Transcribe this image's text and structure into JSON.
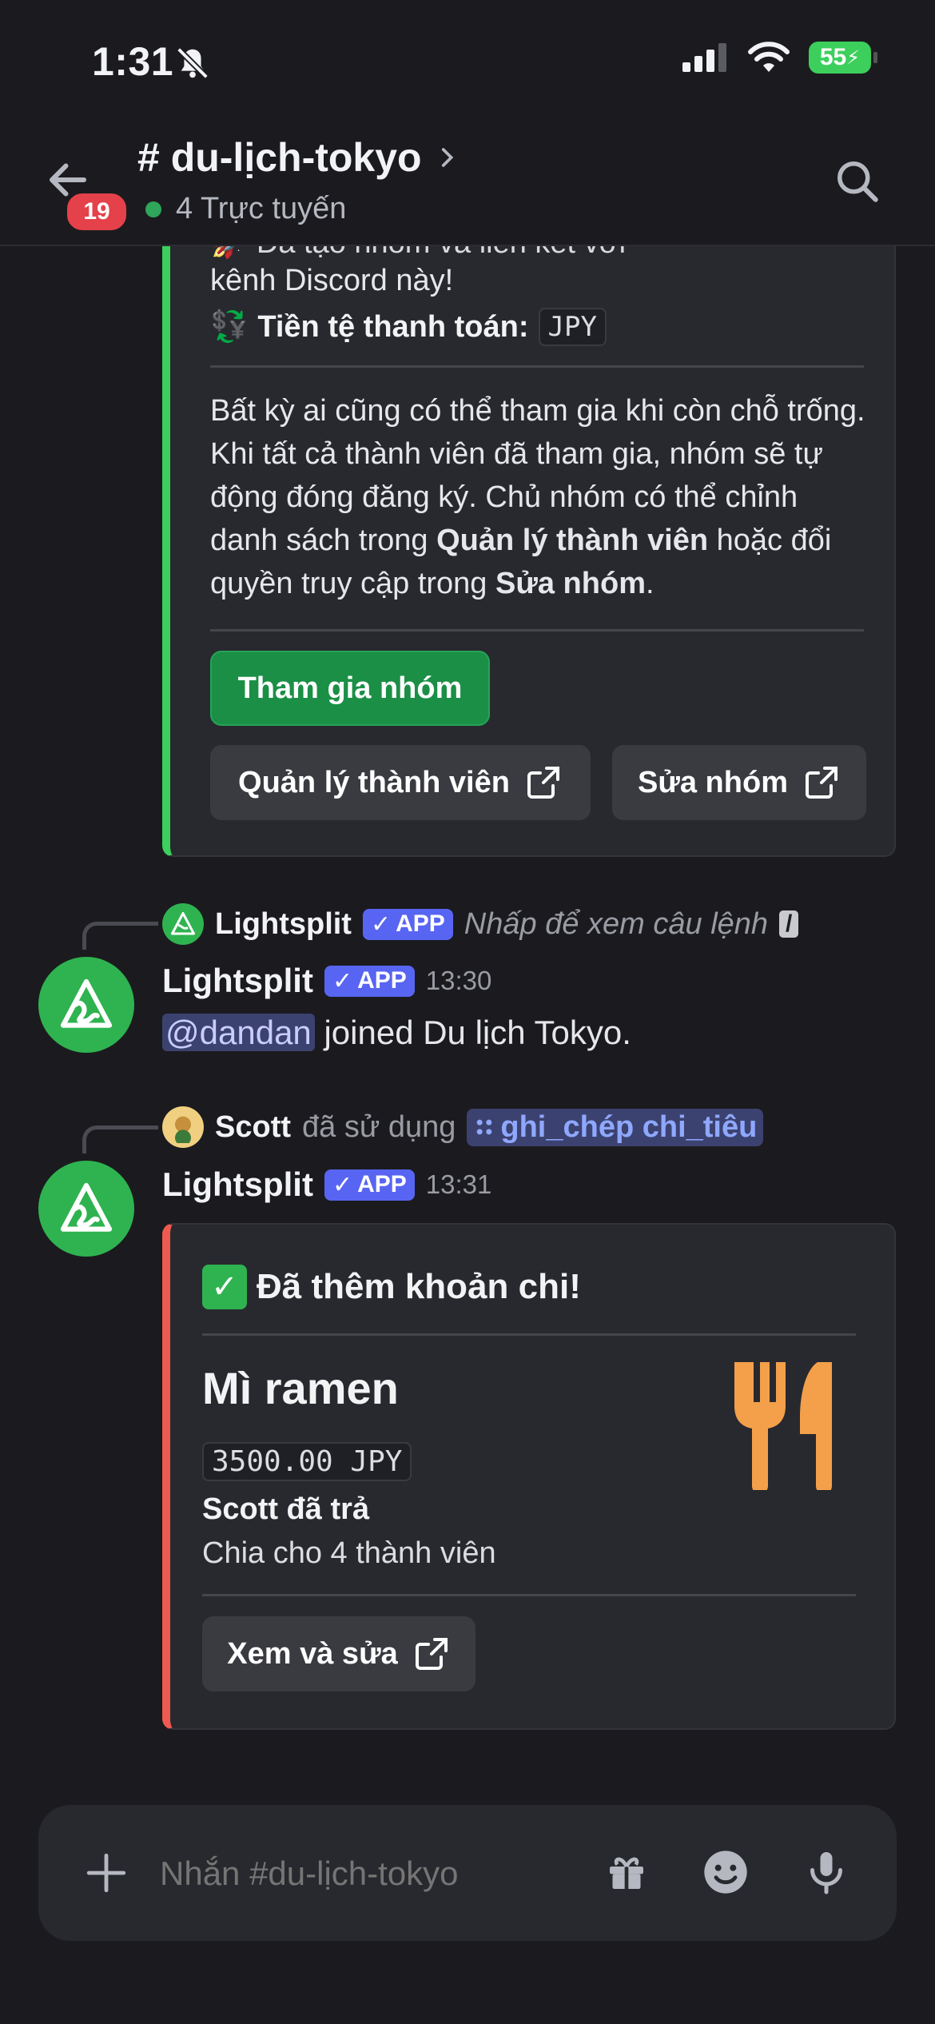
{
  "status_bar": {
    "time": "1:31",
    "battery": "55"
  },
  "header": {
    "channel_name": "# du-lịch-tokyo",
    "online_text": "4 Trực tuyến",
    "back_badge": "19"
  },
  "embed_top": {
    "cut_line": "Đã tạo nhóm và liên kết với",
    "line2": "kênh Discord này!",
    "currency_emoji": "💱",
    "currency_label": "Tiền tệ thanh toán:",
    "currency_value": "JPY",
    "para_1": "Bất kỳ ai cũng có thể tham gia khi còn chỗ trống. Khi tất cả thành viên đã tham gia, nhóm sẽ tự động đóng đăng ký. Chủ nhóm có thể chỉnh danh sách trong ",
    "para_bold_1": "Quản lý thành viên",
    "para_2": " hoặc đổi quyền truy cập trong ",
    "para_bold_2": "Sửa nhóm",
    "para_3": ".",
    "join_button": "Tham gia nhóm",
    "manage_button": "Quản lý thành viên",
    "edit_button": "Sửa nhóm"
  },
  "message_1": {
    "reply_name": "Lightsplit",
    "reply_hint": "Nhấp để xem câu lệnh",
    "app_tag": "APP",
    "author": "Lightsplit",
    "time": "13:30",
    "mention": "@dandan",
    "text": " joined Du lịch Tokyo."
  },
  "message_2": {
    "reply_name": "Scott",
    "reply_used": "đã sử dụng",
    "command": "ghi_chép chi_tiêu",
    "app_tag": "APP",
    "author": "Lightsplit",
    "time": "13:31"
  },
  "embed_expense": {
    "title_emoji": "✅",
    "title": "Đã thêm khoản chi!",
    "item": "Mì ramen",
    "amount": "3500.00 JPY",
    "paid_by": "Scott đã trả",
    "split": "Chia cho 4 thành viên",
    "view_button": "Xem và sửa"
  },
  "composer": {
    "placeholder": "Nhắn #du-lịch-tokyo"
  },
  "colors": {
    "accent_green": "#3ccf5c",
    "accent_red": "#ef5a50",
    "app_blue": "#5865f2"
  }
}
